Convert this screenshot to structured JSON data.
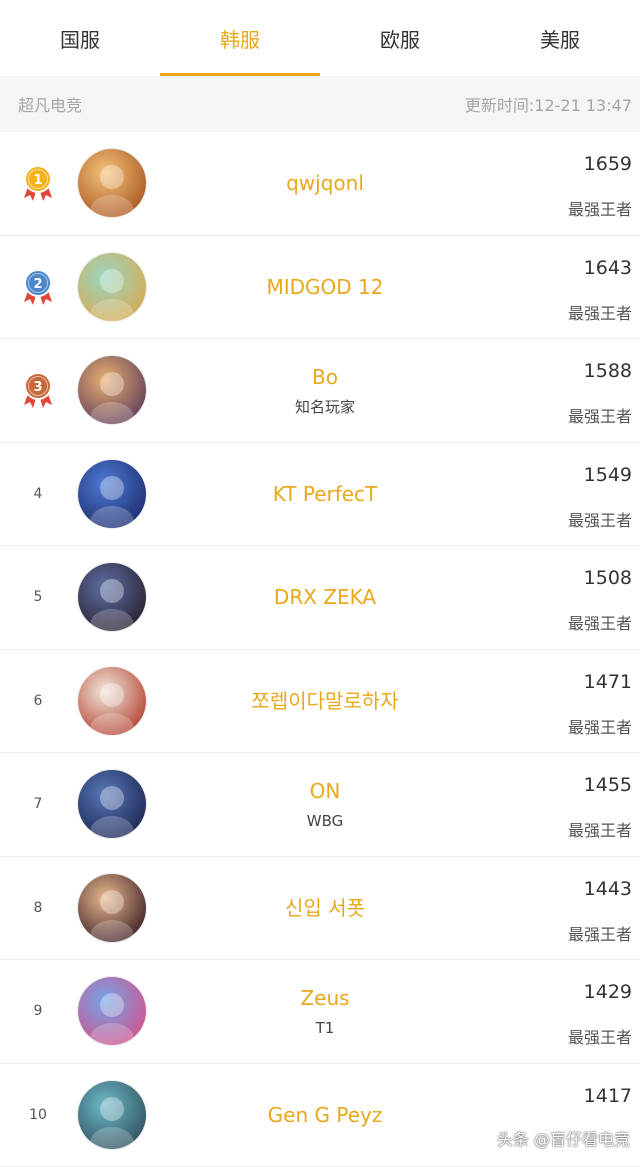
{
  "tabs": [
    {
      "label": "国服",
      "active": false
    },
    {
      "label": "韩服",
      "active": true
    },
    {
      "label": "欧服",
      "active": false
    },
    {
      "label": "美服",
      "active": false
    }
  ],
  "subheader": {
    "source": "超凡电竞",
    "updated": "更新时间:12-21 13:47"
  },
  "players": [
    {
      "rank": "1",
      "name": "qwjqonl",
      "team": "",
      "score": "1659",
      "tier": "最强王者",
      "medal": "gold",
      "avatar": [
        "#f3c47a",
        "#a8531f"
      ]
    },
    {
      "rank": "2",
      "name": "MIDGOD 12",
      "team": "",
      "score": "1643",
      "tier": "最强王者",
      "medal": "silver",
      "avatar": [
        "#9ad7c2",
        "#d9a84d"
      ]
    },
    {
      "rank": "3",
      "name": "Bo",
      "team": "知名玩家",
      "score": "1588",
      "tier": "最强王者",
      "medal": "bronze",
      "avatar": [
        "#e6b071",
        "#5d3a5a"
      ]
    },
    {
      "rank": "4",
      "name": "KT PerfecT",
      "team": "",
      "score": "1549",
      "tier": "最强王者",
      "medal": "",
      "avatar": [
        "#4f7cd6",
        "#1b2a6b"
      ]
    },
    {
      "rank": "5",
      "name": "DRX ZEKA",
      "team": "",
      "score": "1508",
      "tier": "最强王者",
      "medal": "",
      "avatar": [
        "#5c6fa3",
        "#2a1e2e"
      ]
    },
    {
      "rank": "6",
      "name": "쪼렙이다말로하자",
      "team": "",
      "score": "1471",
      "tier": "最强王者",
      "medal": "",
      "avatar": [
        "#f1e8dc",
        "#b23d2d"
      ]
    },
    {
      "rank": "7",
      "name": "ON",
      "team": "WBG",
      "score": "1455",
      "tier": "最强王者",
      "medal": "",
      "avatar": [
        "#5877b8",
        "#1a2550"
      ]
    },
    {
      "rank": "8",
      "name": "신입 서폿",
      "team": "",
      "score": "1443",
      "tier": "最强王者",
      "medal": "",
      "avatar": [
        "#e8b98e",
        "#3a1d25"
      ]
    },
    {
      "rank": "9",
      "name": "Zeus",
      "team": "T1",
      "score": "1429",
      "tier": "最强王者",
      "medal": "",
      "avatar": [
        "#72a6e8",
        "#d74f8a"
      ]
    },
    {
      "rank": "10",
      "name": "Gen G Peyz",
      "team": "",
      "score": "1417",
      "tier": "",
      "medal": "",
      "avatar": [
        "#6fb9c9",
        "#2d4e5a"
      ]
    }
  ],
  "watermark": "头条 @盲仔看电竞",
  "colors": {
    "accent": "#e8a71c",
    "gold": "#f2b31f",
    "silver": "#4d86c9",
    "bronze": "#c7693a",
    "ribbon": "#e0463a"
  }
}
